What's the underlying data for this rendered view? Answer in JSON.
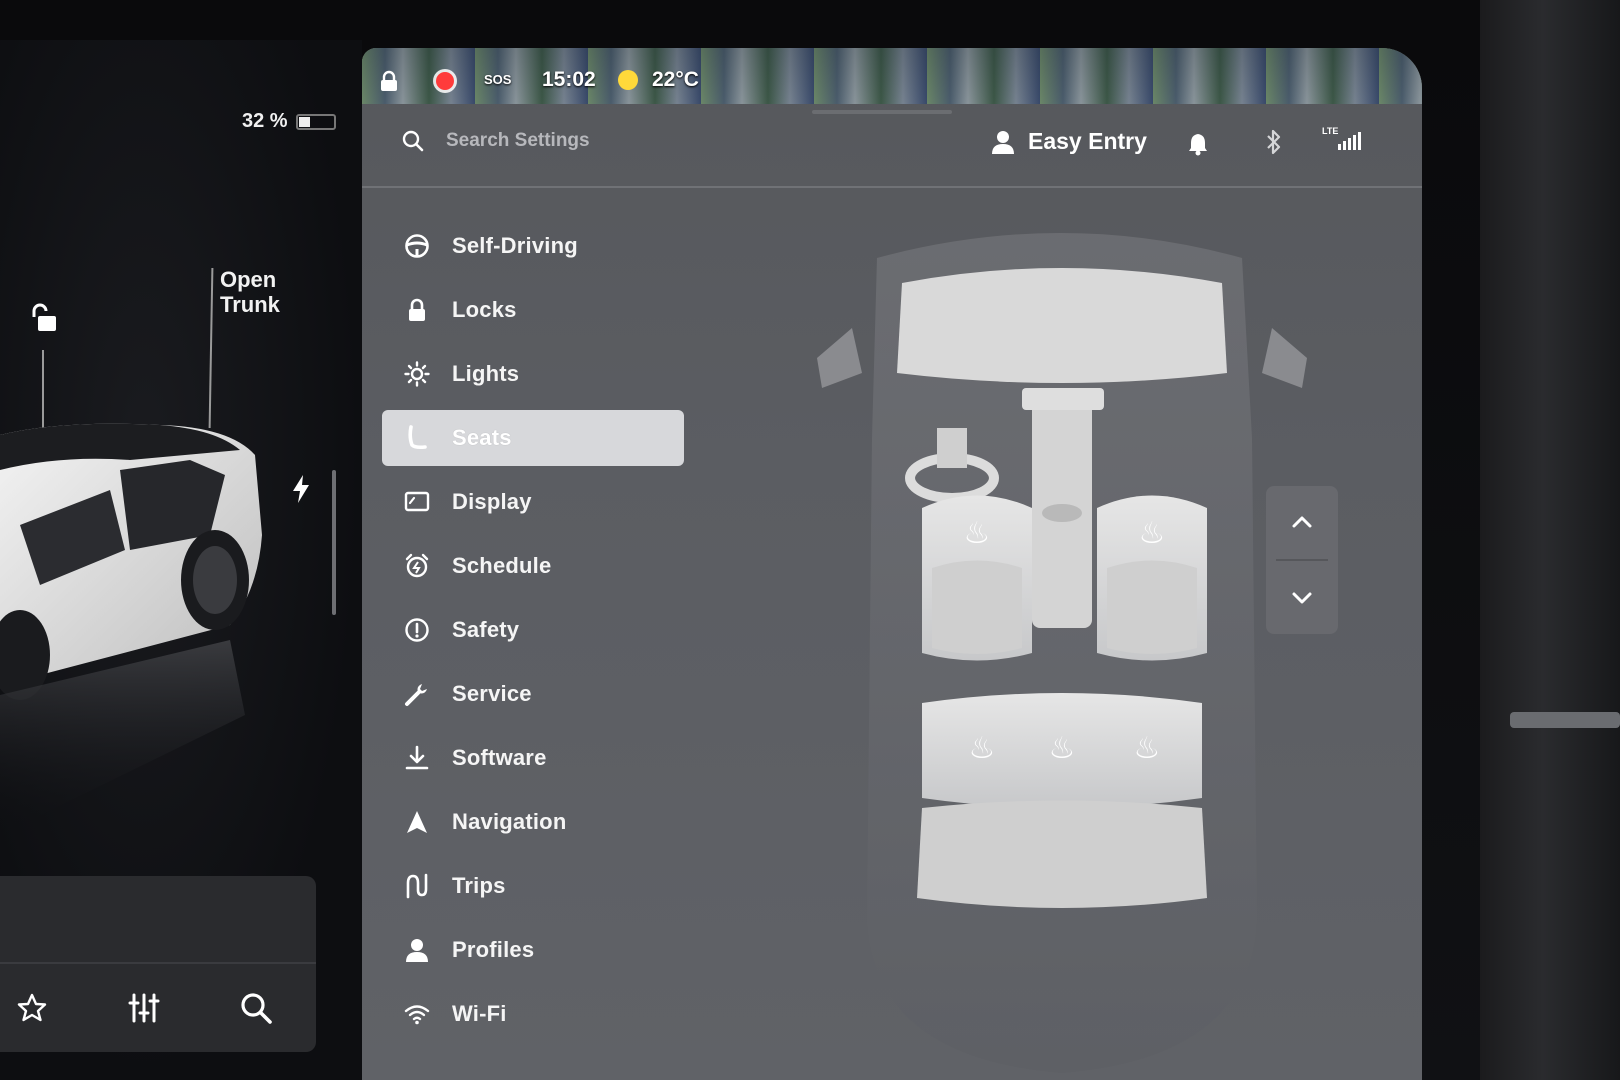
{
  "car_panel": {
    "battery_text": "32 %",
    "battery_level": 0.32,
    "trunk_label_line1": "Open",
    "trunk_label_line2": "Trunk"
  },
  "status_bar": {
    "sos": "SOS",
    "time": "15:02",
    "temperature": "22°C"
  },
  "header": {
    "search_placeholder": "Search Settings",
    "profile_name": "Easy Entry",
    "lte": "LTE"
  },
  "menu": {
    "items": [
      {
        "label": "Self-Driving",
        "icon": "steering-wheel-icon"
      },
      {
        "label": "Locks",
        "icon": "lock-icon"
      },
      {
        "label": "Lights",
        "icon": "sun-icon"
      },
      {
        "label": "Seats",
        "icon": "seat-icon",
        "active": true
      },
      {
        "label": "Display",
        "icon": "display-icon"
      },
      {
        "label": "Schedule",
        "icon": "alarm-clock-icon"
      },
      {
        "label": "Safety",
        "icon": "alert-circle-icon"
      },
      {
        "label": "Service",
        "icon": "wrench-icon"
      },
      {
        "label": "Software",
        "icon": "download-icon"
      },
      {
        "label": "Navigation",
        "icon": "navigation-arrow-icon"
      },
      {
        "label": "Trips",
        "icon": "trips-icon"
      },
      {
        "label": "Profiles",
        "icon": "person-icon"
      },
      {
        "label": "Wi-Fi",
        "icon": "wifi-icon"
      }
    ]
  },
  "dock": {
    "icons": [
      "star-icon",
      "sliders-icon",
      "search-icon"
    ]
  },
  "colors": {
    "screen_bg": "#5a5c61",
    "active_item_bg": "#d7d8db",
    "record_red": "#ff3b3b"
  }
}
